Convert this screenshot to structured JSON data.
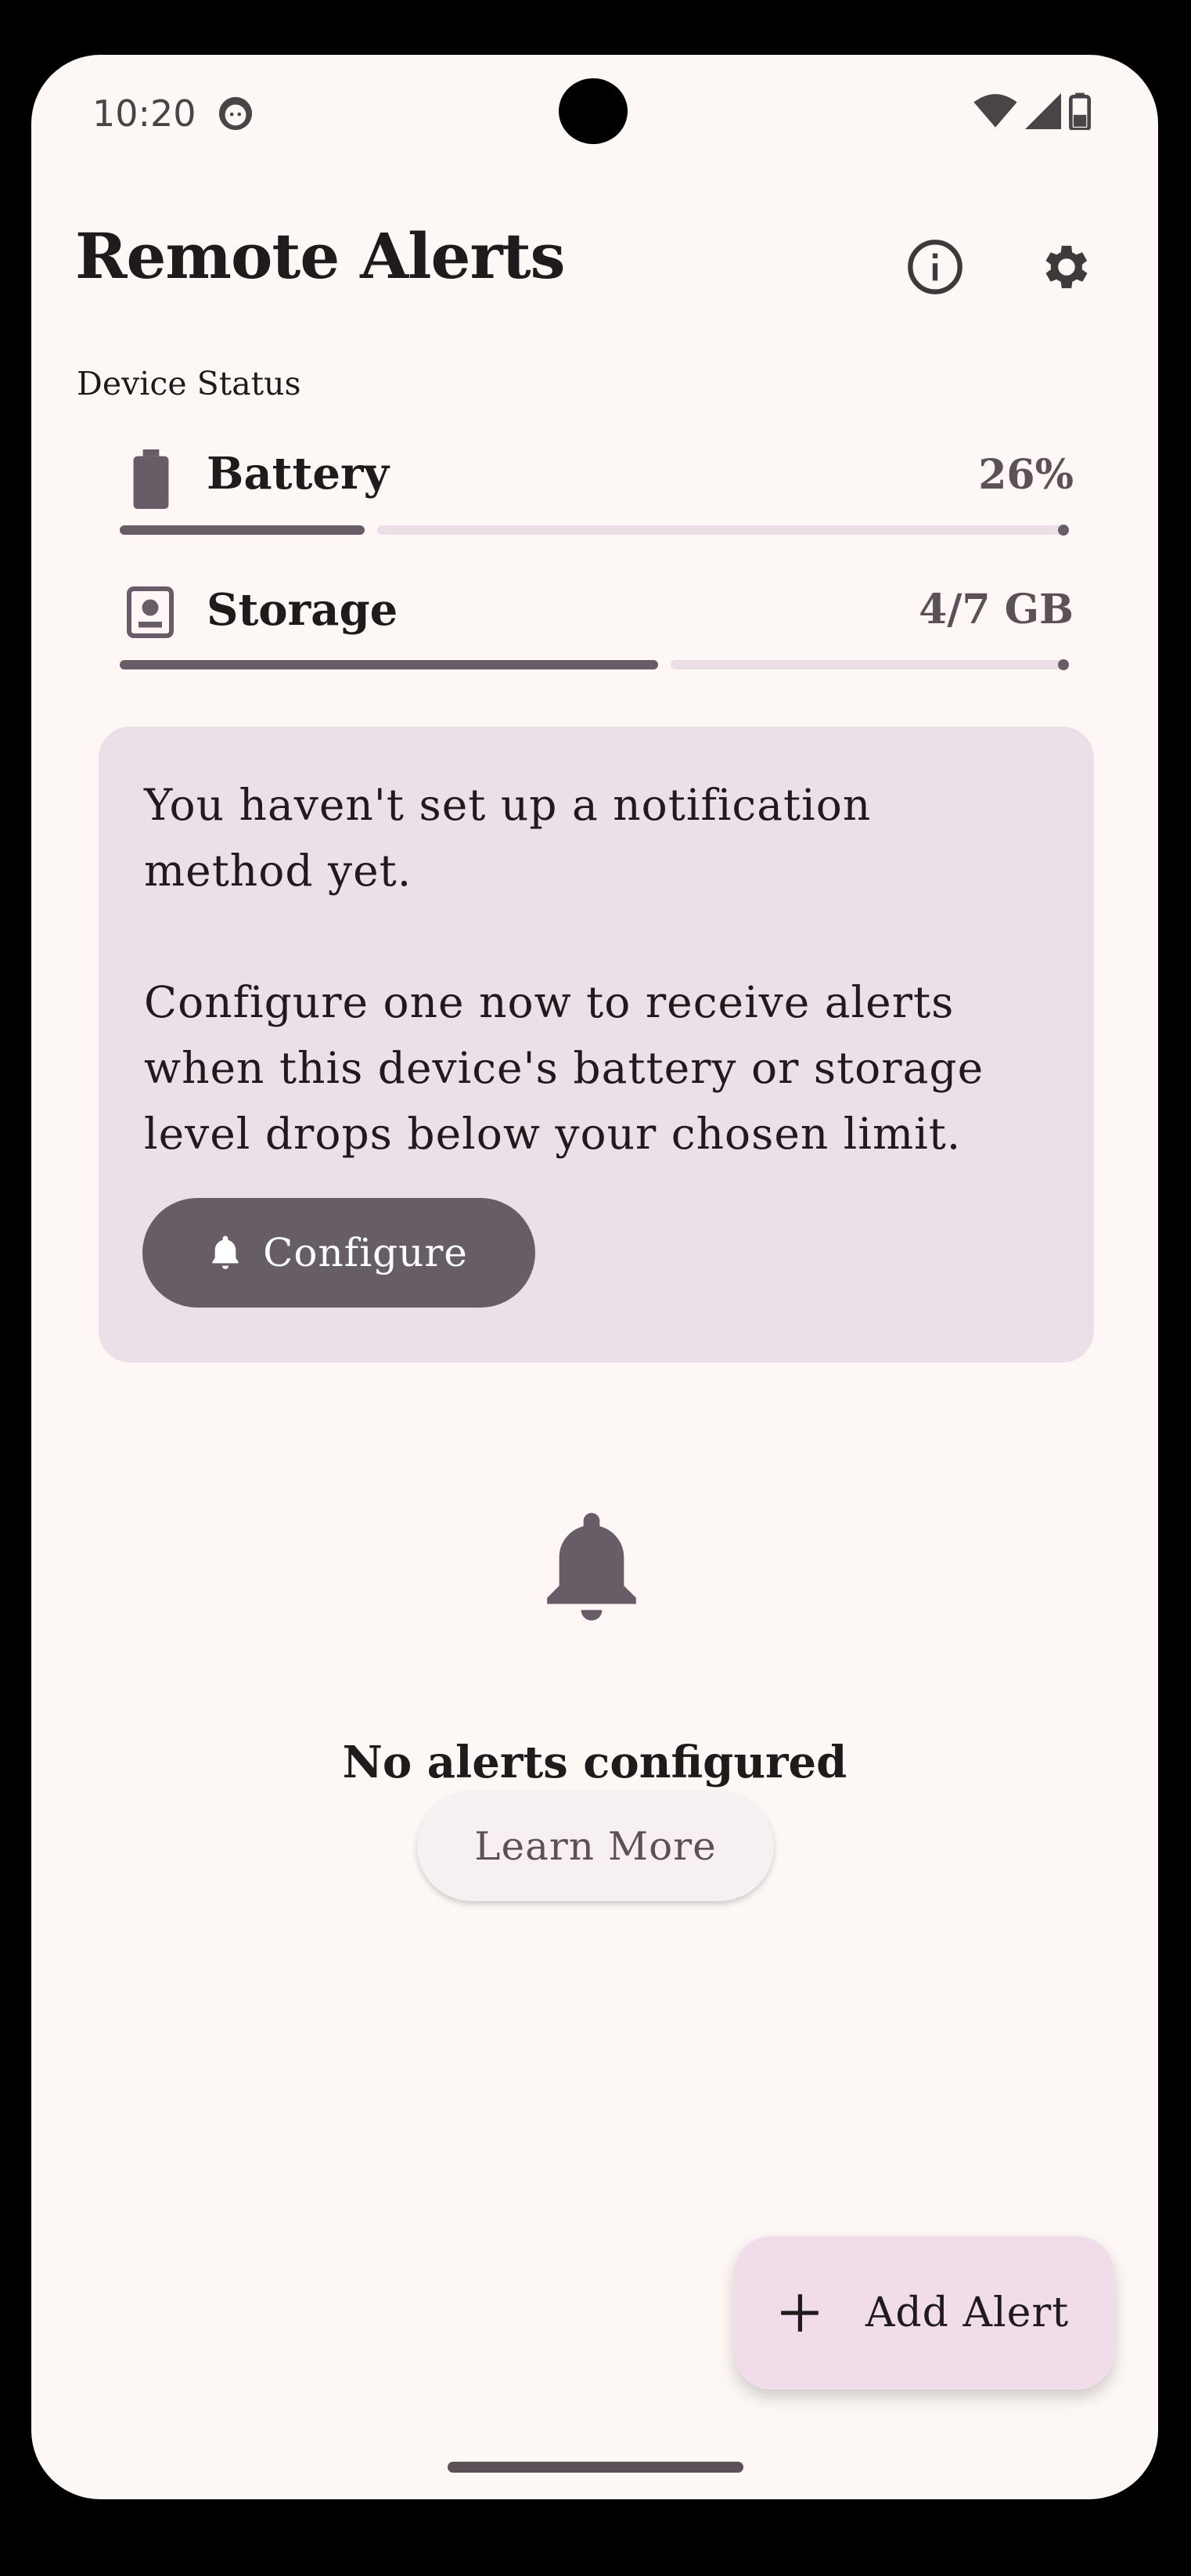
{
  "status_bar": {
    "time": "10:20"
  },
  "header": {
    "title": "Remote Alerts"
  },
  "device_status": {
    "label": "Device Status",
    "battery": {
      "name": "Battery",
      "value": "26%",
      "level": 0.26
    },
    "storage": {
      "name": "Storage",
      "value": "4/7 GB",
      "level": 0.571
    }
  },
  "setup_card": {
    "message": "You haven't set up a notification\nmethod yet.\n\nConfigure one now to receive alerts\nwhen this device's battery or storage\nlevel drops below your chosen limit.",
    "button_label": "Configure"
  },
  "empty_state": {
    "title": "No alerts configured",
    "button_label": "Learn More"
  },
  "fab": {
    "label": "Add Alert"
  },
  "colors": {
    "primary": "#675d66",
    "surface": "#fdf7f6",
    "card": "#ebdfe8",
    "fab": "#f0dde9"
  }
}
